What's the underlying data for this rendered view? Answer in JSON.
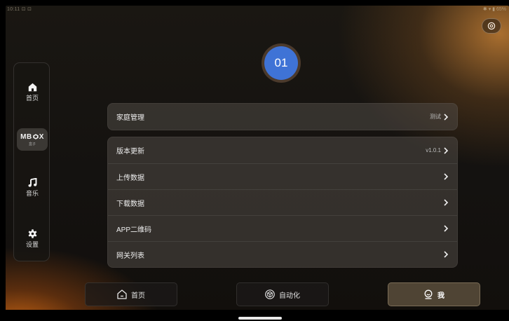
{
  "status_bar": {
    "left": "10:11 ⊡ ⊡",
    "right": "✱ ▾ ▮ 65%"
  },
  "top_right": {
    "icon": "settings-icon"
  },
  "sidebar": {
    "items": [
      {
        "label": "首页",
        "icon": "home-icon"
      },
      {
        "logo": "MBOX",
        "sub": "盒子",
        "icon": "mbox-logo-icon"
      },
      {
        "label": "音乐",
        "icon": "music-note-icon"
      },
      {
        "label": "设置",
        "icon": "gear-icon"
      }
    ]
  },
  "profile": {
    "avatar_text": "01",
    "avatar_color": "#3f73d6"
  },
  "family_card": {
    "title": "家庭管理",
    "value": "测试"
  },
  "menu": {
    "rows": [
      {
        "title": "版本更新",
        "value": "v1.0.1"
      },
      {
        "title": "上传数据",
        "value": ""
      },
      {
        "title": "下载数据",
        "value": ""
      },
      {
        "title": "APP二维码",
        "value": ""
      },
      {
        "title": "网关列表",
        "value": ""
      }
    ]
  },
  "bottom_nav": {
    "items": [
      {
        "label": "首页",
        "icon": "home-outline-icon",
        "active": false
      },
      {
        "label": "自动化",
        "icon": "cube-icon",
        "active": false
      },
      {
        "label": "我",
        "icon": "user-icon",
        "active": true
      }
    ]
  },
  "colors": {
    "accent": "#3f73d6",
    "active_tab": "#4f4434",
    "glow": "#c8641a"
  }
}
